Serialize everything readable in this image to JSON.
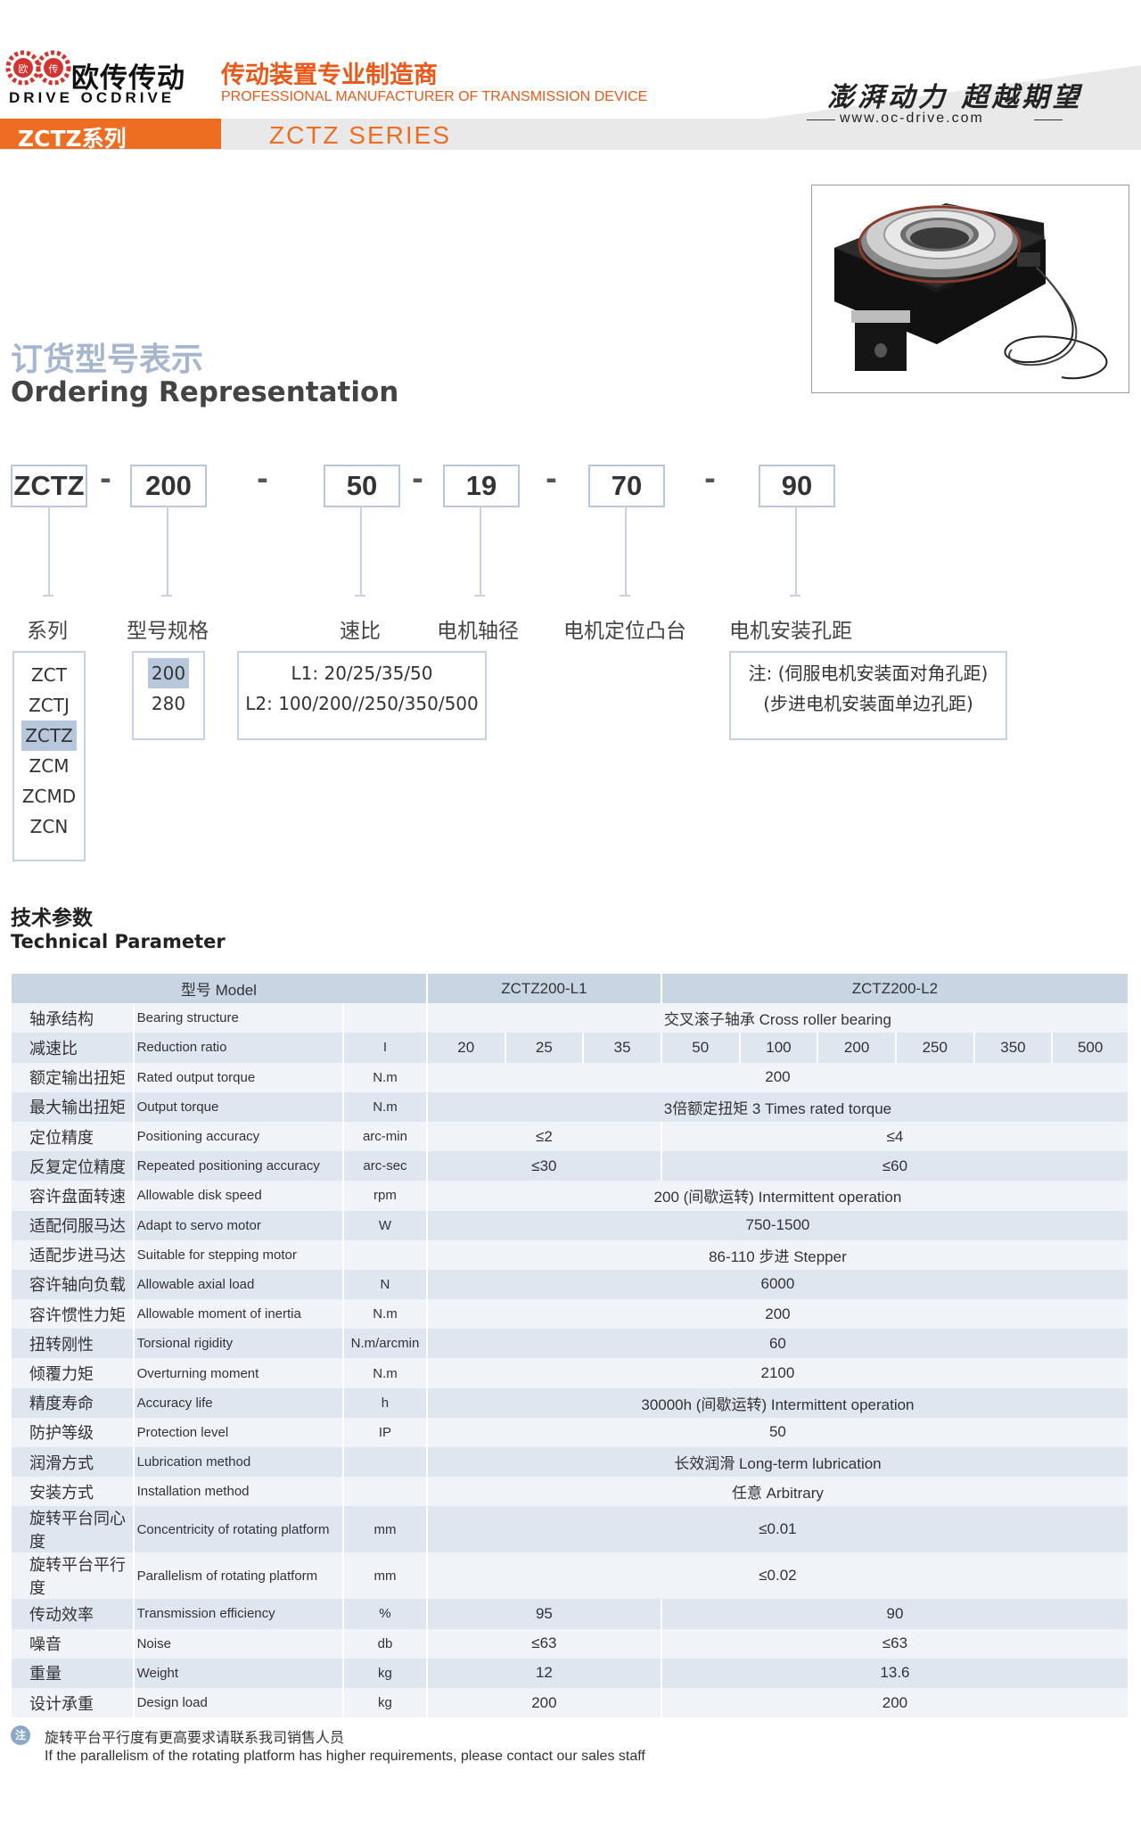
{
  "header": {
    "logo_zh": "欧传传动",
    "logo_en": "DRIVE OCDRIVE",
    "logo_mark_chars": [
      "欧",
      "传"
    ],
    "tagline_zh": "传动装置专业制造商",
    "tagline_en": "PROFESSIONAL MANUFACTURER OF TRANSMISSION DEVICE",
    "slogan": "澎湃动力 超越期望",
    "url": "www.oc-drive.com",
    "series_zh": "ZCTZ系列",
    "series_en": "ZCTZ SERIES",
    "colors": {
      "accent": "#ed6d22",
      "table_header": "#c8d5e3",
      "table_dark": "#dfe6ef",
      "table_light": "#f0f3f7"
    }
  },
  "ordering": {
    "title_zh": "订货型号表示",
    "title_en": "Ordering Representation",
    "codes": [
      "ZCTZ",
      "200",
      "50",
      "19",
      "70",
      "90"
    ],
    "dash": "-",
    "columns": [
      "系列",
      "型号规格",
      "速比",
      "电机轴径",
      "电机定位凸台",
      "电机安装孔距"
    ],
    "series_options": [
      "ZCT",
      "ZCTJ",
      "ZCTZ",
      "ZCM",
      "ZCMD",
      "ZCN"
    ],
    "series_selected": "ZCTZ",
    "size_options": [
      "200",
      "280"
    ],
    "size_selected": "200",
    "ratio_l1": "L1: 20/25/35/50",
    "ratio_l2": "L2: 100/200//250/350/500",
    "note_line1": "注: (伺服电机安装面对角孔距)",
    "note_line2": "(步进电机安装面单边孔距)"
  },
  "params": {
    "title_zh": "技术参数",
    "title_en": "Technical Parameter",
    "model_label": "型号 Model",
    "model_l1": "ZCTZ200-L1",
    "model_l2": "ZCTZ200-L2",
    "rows": [
      {
        "zh": "轴承结构",
        "en": "Bearing structure",
        "unit": "",
        "span": "交叉滚子轴承 Cross roller bearing"
      },
      {
        "zh": "减速比",
        "en": "Reduction ratio",
        "unit": "I",
        "ratios": [
          "20",
          "25",
          "35",
          "50",
          "100",
          "200",
          "250",
          "350",
          "500"
        ]
      },
      {
        "zh": "额定输出扭矩",
        "en": "Rated output torque",
        "unit": "N.m",
        "span": "200"
      },
      {
        "zh": "最大输出扭矩",
        "en": "Output torque",
        "unit": "N.m",
        "span": "3倍额定扭矩 3 Times rated torque"
      },
      {
        "zh": "定位精度",
        "en": "Positioning accuracy",
        "unit": "arc-min",
        "l1": "≤2",
        "l2": "≤4"
      },
      {
        "zh": "反复定位精度",
        "en": "Repeated positioning accuracy",
        "unit": "arc-sec",
        "l1": "≤30",
        "l2": "≤60"
      },
      {
        "zh": "容许盘面转速",
        "en": "Allowable disk speed",
        "unit": "rpm",
        "span": "200 (间歇运转) Intermittent operation"
      },
      {
        "zh": "适配伺服马达",
        "en": "Adapt to servo motor",
        "unit": "W",
        "span": "750-1500"
      },
      {
        "zh": "适配步进马达",
        "en": "Suitable for stepping motor",
        "unit": "",
        "span": "86-110 步进 Stepper"
      },
      {
        "zh": "容许轴向负载",
        "en": "Allowable axial load",
        "unit": "N",
        "span": "6000"
      },
      {
        "zh": "容许惯性力矩",
        "en": "Allowable moment of inertia",
        "unit": "N.m",
        "span": "200"
      },
      {
        "zh": "扭转刚性",
        "en": "Torsional rigidity",
        "unit": "N.m/arcmin",
        "span": "60"
      },
      {
        "zh": "倾覆力矩",
        "en": "Overturning moment",
        "unit": "N.m",
        "span": "2100"
      },
      {
        "zh": "精度寿命",
        "en": "Accuracy life",
        "unit": "h",
        "span": "30000h (间歇运转) Intermittent operation"
      },
      {
        "zh": "防护等级",
        "en": "Protection level",
        "unit": "IP",
        "span": "50"
      },
      {
        "zh": "润滑方式",
        "en": "Lubrication method",
        "unit": "",
        "span": "长效润滑 Long-term lubrication"
      },
      {
        "zh": "安装方式",
        "en": "Installation method",
        "unit": "",
        "span": "任意 Arbitrary"
      },
      {
        "zh": "旋转平台同心度",
        "en": "Concentricity of rotating platform",
        "unit": "mm",
        "span": "≤0.01"
      },
      {
        "zh": "旋转平台平行度",
        "en": "Parallelism of rotating platform",
        "unit": "mm",
        "span": "≤0.02"
      },
      {
        "zh": "传动效率",
        "en": "Transmission efficiency",
        "unit": "%",
        "l1": "95",
        "l2": "90"
      },
      {
        "zh": "噪音",
        "en": "Noise",
        "unit": "db",
        "l1": "≤63",
        "l2": "≤63"
      },
      {
        "zh": "重量",
        "en": "Weight",
        "unit": "kg",
        "l1": "12",
        "l2": "13.6"
      },
      {
        "zh": "设计承重",
        "en": "Design load",
        "unit": "kg",
        "l1": "200",
        "l2": "200"
      }
    ]
  },
  "footnote": {
    "zh": "旋转平台平行度有更高要求请联系我司销售人员",
    "en": "If the parallelism of the rotating platform has higher requirements, please contact our sales staff"
  }
}
